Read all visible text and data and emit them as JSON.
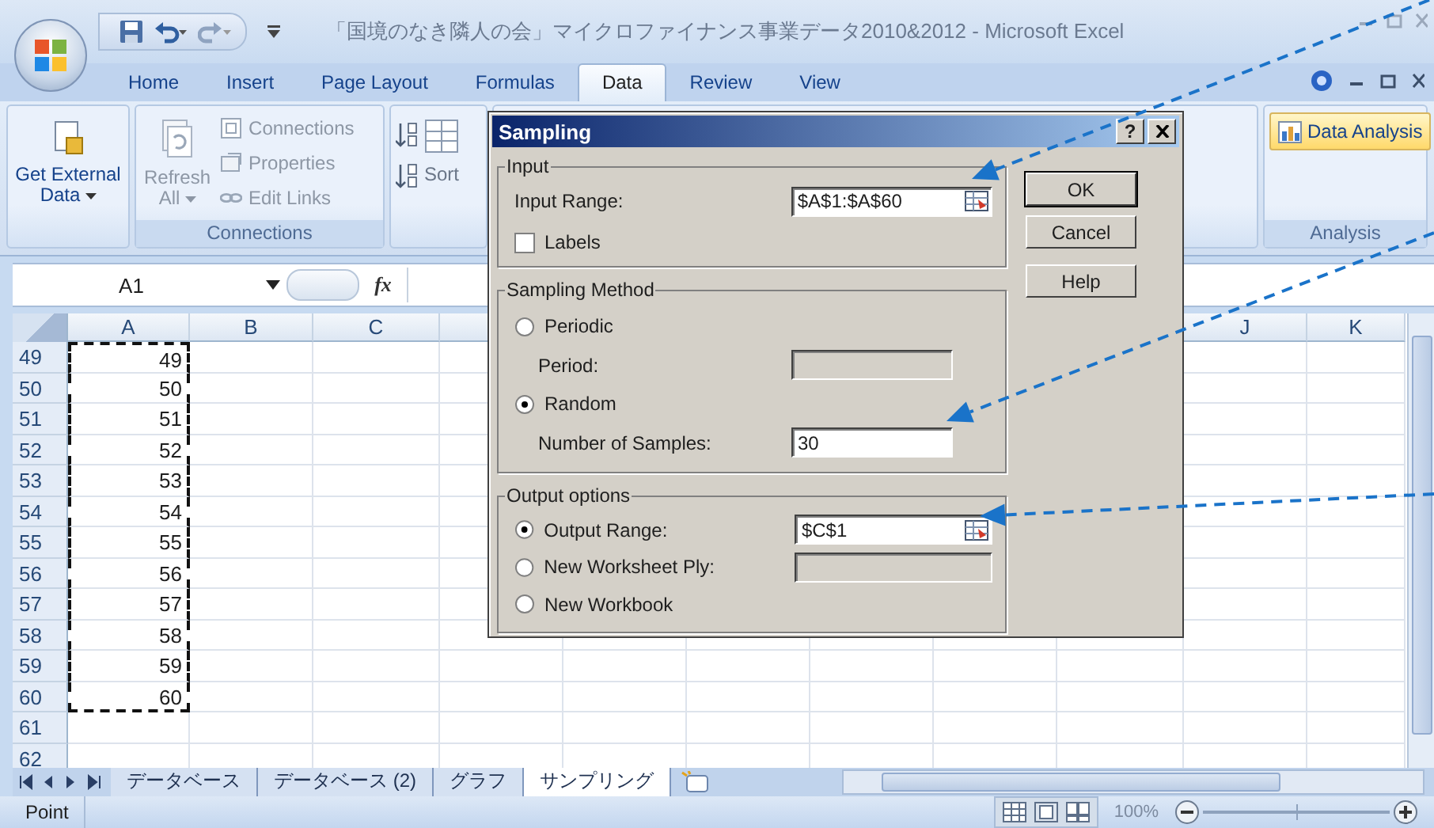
{
  "window": {
    "title": "「国境のなき隣人の会」マイクロファイナンス事業データ2010&2012 - Microsoft Excel"
  },
  "ribbon_tabs": [
    {
      "label": "Home",
      "selected": false
    },
    {
      "label": "Insert",
      "selected": false
    },
    {
      "label": "Page Layout",
      "selected": false
    },
    {
      "label": "Formulas",
      "selected": false
    },
    {
      "label": "Data",
      "selected": true
    },
    {
      "label": "Review",
      "selected": false
    },
    {
      "label": "View",
      "selected": false
    }
  ],
  "ribbon": {
    "get_external_data": {
      "lines": [
        "Get External",
        "Data"
      ]
    },
    "connections_group": {
      "label": "Connections",
      "refresh": {
        "lines": [
          "Refresh",
          "All"
        ],
        "disabled": true
      },
      "items": [
        {
          "label": "Connections",
          "disabled": true
        },
        {
          "label": "Properties",
          "disabled": true
        },
        {
          "label": "Edit Links",
          "disabled": true
        }
      ]
    },
    "sort_group": {
      "sort_label": "Sort"
    },
    "analysis_group": {
      "label": "Analysis",
      "button": {
        "label": "Data Analysis",
        "highlighted": true
      }
    }
  },
  "formula_bar": {
    "name_box": "A1",
    "fx": "fx"
  },
  "sheet": {
    "columns": [
      {
        "label": "A"
      },
      {
        "label": "B"
      },
      {
        "label": "C"
      },
      {
        "label": "J"
      },
      {
        "label": "K"
      }
    ],
    "rows": [
      {
        "header": "49",
        "value": "49",
        "in_range": true
      },
      {
        "header": "50",
        "value": "50",
        "in_range": true
      },
      {
        "header": "51",
        "value": "51",
        "in_range": true
      },
      {
        "header": "52",
        "value": "52",
        "in_range": true
      },
      {
        "header": "53",
        "value": "53",
        "in_range": true
      },
      {
        "header": "54",
        "value": "54",
        "in_range": true
      },
      {
        "header": "55",
        "value": "55",
        "in_range": true
      },
      {
        "header": "56",
        "value": "56",
        "in_range": true
      },
      {
        "header": "57",
        "value": "57",
        "in_range": true
      },
      {
        "header": "58",
        "value": "58",
        "in_range": true
      },
      {
        "header": "59",
        "value": "59",
        "in_range": true
      },
      {
        "header": "60",
        "value": "60",
        "in_range": true
      },
      {
        "header": "61",
        "in_range": false
      },
      {
        "header": "62",
        "in_range": false
      }
    ]
  },
  "sheet_tabs": [
    {
      "label": "データベース",
      "selected": false
    },
    {
      "label": "データベース (2)",
      "selected": false
    },
    {
      "label": "グラフ",
      "selected": false
    },
    {
      "label": "サンプリング",
      "selected": true
    }
  ],
  "status_bar": {
    "mode": "Point",
    "zoom": "100%",
    "zoom_slider": {
      "level": 0.5
    }
  },
  "dialog": {
    "title": "Sampling",
    "help_button": "?",
    "input": {
      "legend": "Input",
      "range": {
        "label": "Input Range:",
        "value": "$A$1:$A$60",
        "picker": true
      },
      "labels_checkbox": {
        "label": "Labels",
        "checked": false
      }
    },
    "method": {
      "legend": "Sampling Method",
      "options": [
        {
          "label": "Periodic",
          "selected": false,
          "field": {
            "label": "Period:",
            "disabled": true
          }
        },
        {
          "label": "Random",
          "selected": true,
          "field": {
            "label": "Number of Samples:",
            "value": "30",
            "disabled": false
          }
        }
      ]
    },
    "output": {
      "legend": "Output options",
      "options": [
        {
          "label": "Output Range:",
          "selected": true,
          "field": {
            "value": "$C$1",
            "disabled": false,
            "picker": true
          }
        },
        {
          "label": "New Worksheet Ply:",
          "selected": false,
          "field": {
            "disabled": true
          }
        },
        {
          "label": "New Workbook",
          "selected": false
        }
      ]
    },
    "buttons": [
      {
        "label": "OK",
        "default": true
      },
      {
        "label": "Cancel",
        "default": false
      },
      {
        "label": "Help",
        "default": false
      }
    ]
  }
}
